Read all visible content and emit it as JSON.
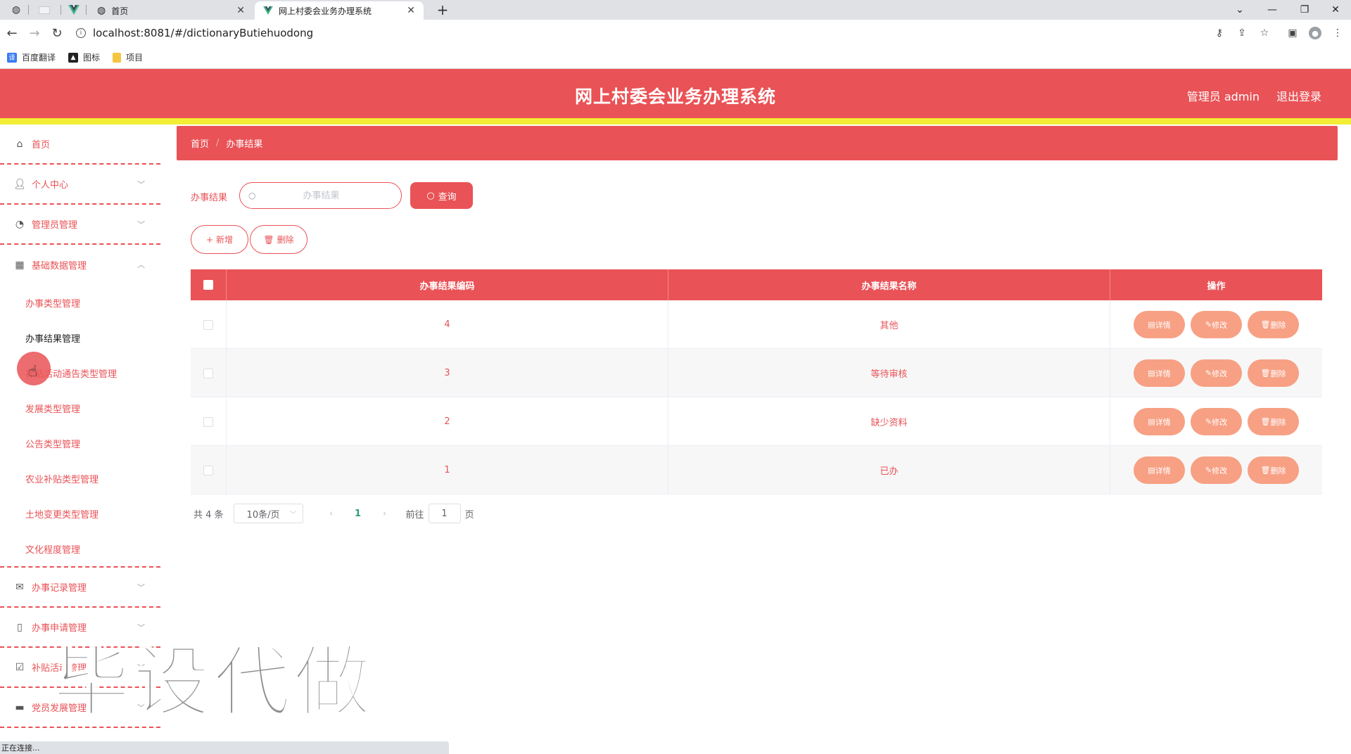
{
  "browser": {
    "tabs": [
      {
        "title": "首页"
      },
      {
        "title": "网上村委会业务办理系统"
      }
    ],
    "url": "localhost:8081/#/dictionaryButiehuodong",
    "bookmarks": [
      {
        "label": "百度翻译"
      },
      {
        "label": "图标"
      },
      {
        "label": "项目"
      }
    ],
    "status_text": "正在连接..."
  },
  "header": {
    "title": "网上村委会业务办理系统",
    "user_label": "管理员 admin",
    "logout_label": "退出登录"
  },
  "sidebar": {
    "items": [
      {
        "label": "首页"
      },
      {
        "label": "个人中心"
      },
      {
        "label": "管理员管理"
      },
      {
        "label": "基础数据管理"
      },
      {
        "label": "办事记录管理"
      },
      {
        "label": "办事申请管理"
      },
      {
        "label": "补贴活动管理"
      },
      {
        "label": "党员发展管理"
      }
    ],
    "sub_items": [
      {
        "label": "办事类型管理"
      },
      {
        "label": "办事结果管理"
      },
      {
        "label": "补贴活动通告类型管理"
      },
      {
        "label": "发展类型管理"
      },
      {
        "label": "公告类型管理"
      },
      {
        "label": "农业补贴类型管理"
      },
      {
        "label": "土地变更类型管理"
      },
      {
        "label": "文化程度管理"
      }
    ]
  },
  "breadcrumb": {
    "home": "首页",
    "current": "办事结果"
  },
  "search": {
    "label": "办事结果",
    "placeholder": "办事结果",
    "button_label": "查询"
  },
  "actions": {
    "add_label": "新增",
    "delete_label": "删除"
  },
  "table": {
    "columns": [
      "办事结果编码",
      "办事结果名称",
      "操作"
    ],
    "rows": [
      {
        "code": "4",
        "name": "其他"
      },
      {
        "code": "3",
        "name": "等待审核"
      },
      {
        "code": "2",
        "name": "缺少资料"
      },
      {
        "code": "1",
        "name": "已办"
      }
    ],
    "row_actions": {
      "detail": "详情",
      "edit": "修改",
      "delete": "删除"
    }
  },
  "pagination": {
    "total_text": "共 4 条",
    "page_size": "10条/页",
    "current_page": "1",
    "goto_prefix": "前往",
    "goto_value": "1",
    "goto_suffix": "页"
  },
  "watermark": "毕设代做",
  "colors": {
    "primary": "#e95256",
    "accent_yellow": "#f3ee35",
    "action_button": "#f7a084"
  }
}
